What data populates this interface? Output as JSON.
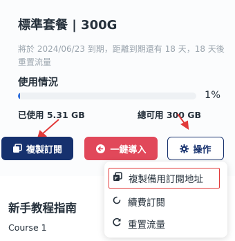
{
  "plan": {
    "title": "標準套餐 | 300G",
    "expiry_note": "將於 2024/06/23 到期，距離到期還有 18 天，18 天後重置流量"
  },
  "usage": {
    "title": "使用情況",
    "progress_fraction": 0.01,
    "percent_label": "1%",
    "used_label": "已使用 5.31 GB",
    "total_label": "總可用 300 GB"
  },
  "actions": {
    "copy_label": "複製訂閱",
    "import_label": "一鍵導入",
    "ops_label": "操作"
  },
  "menu": {
    "items": [
      {
        "label": "複製備用訂閱地址",
        "icon": "copy-icon"
      },
      {
        "label": "續費訂閱",
        "icon": "refresh-icon"
      },
      {
        "label": "重置流量",
        "icon": "reset-icon"
      }
    ]
  },
  "guide": {
    "title": "新手教程指南",
    "course_label": "Course 1"
  },
  "colors": {
    "primary": "#16316e",
    "danger": "#e1485a",
    "progress": "#2f6fdc",
    "annotation": "#e23a3a"
  }
}
